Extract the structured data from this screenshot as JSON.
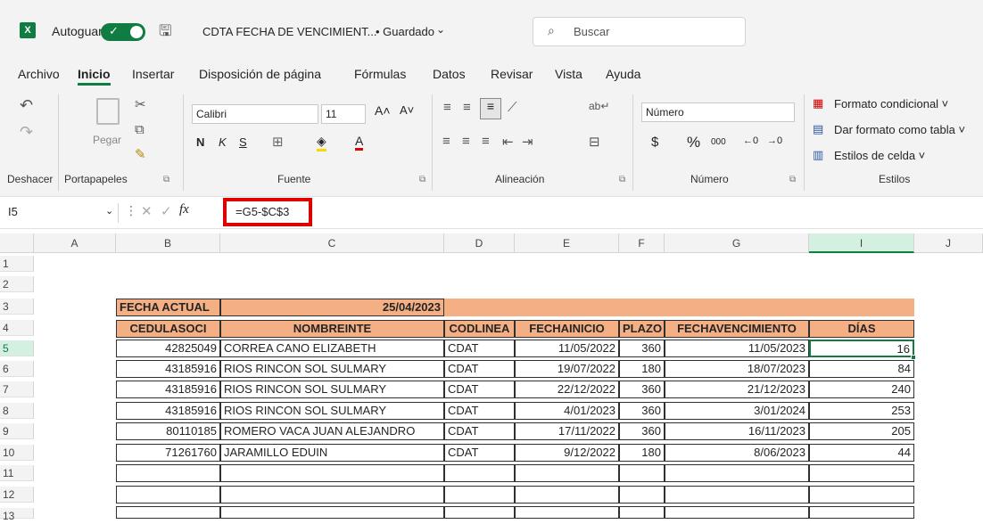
{
  "titlebar": {
    "app_icon": "excel-icon",
    "app_icon_letter": "X",
    "autosave_label": "Autoguardado",
    "autosave_on": true,
    "filename": "CDTA FECHA DE VENCIMIENT...",
    "save_status": "• Guardado",
    "search_placeholder": "Buscar"
  },
  "menu": [
    "Archivo",
    "Inicio",
    "Insertar",
    "Disposición de página",
    "Fórmulas",
    "Datos",
    "Revisar",
    "Vista",
    "Ayuda"
  ],
  "ribbon": {
    "groups": {
      "undo": "Deshacer",
      "clipboard": "Portapapeles",
      "font": "Fuente",
      "alignment": "Alineación",
      "number": "Número",
      "styles": "Estilos"
    },
    "paste_label": "Pegar",
    "font_name": "Calibri",
    "font_size": "11",
    "number_format": "Número",
    "bold": "N",
    "italic": "K",
    "underline": "S",
    "currency": "$",
    "percent": "%",
    "thousands": "000",
    "styles_buttons": [
      "Formato condicional ˅",
      "Dar formato como tabla ˅",
      "Estilos de celda ˅"
    ]
  },
  "formula_bar": {
    "name_box": "I5",
    "fx": "fx",
    "formula": "=G5-$C$3",
    "highlight_color": "#e00000"
  },
  "columns": [
    "A",
    "B",
    "C",
    "D",
    "E",
    "F",
    "G",
    "I",
    "J"
  ],
  "rows": [
    "1",
    "2",
    "3",
    "4",
    "5",
    "6",
    "7",
    "8",
    "9",
    "10",
    "11",
    "12",
    "13"
  ],
  "sheet": {
    "header_fill": "#f4b084",
    "fecha_actual_label": "FECHA ACTUAL",
    "fecha_actual_value": "25/04/2023",
    "headers": [
      "CEDULASOCI",
      "NOMBREINTE",
      "CODLINEA",
      "FECHAINICIO",
      "PLAZO",
      "FECHAVENCIMIENTO",
      "DÍAS"
    ],
    "records": [
      [
        "42825049",
        "CORREA CANO ELIZABETH",
        "CDAT",
        "11/05/2022",
        "360",
        "11/05/2023",
        "16"
      ],
      [
        "43185916",
        "RIOS RINCON SOL SULMARY",
        "CDAT",
        "19/07/2022",
        "180",
        "18/07/2023",
        "84"
      ],
      [
        "43185916",
        "RIOS RINCON SOL SULMARY",
        "CDAT",
        "22/12/2022",
        "360",
        "21/12/2023",
        "240"
      ],
      [
        "43185916",
        "RIOS RINCON SOL SULMARY",
        "CDAT",
        "4/01/2023",
        "360",
        "3/01/2024",
        "253"
      ],
      [
        "80110185",
        "ROMERO VACA JUAN ALEJANDRO",
        "CDAT",
        "17/11/2022",
        "360",
        "16/11/2023",
        "205"
      ],
      [
        "71261760",
        "JARAMILLO EDUIN",
        "CDAT",
        "9/12/2022",
        "180",
        "8/06/2023",
        "44"
      ]
    ]
  }
}
